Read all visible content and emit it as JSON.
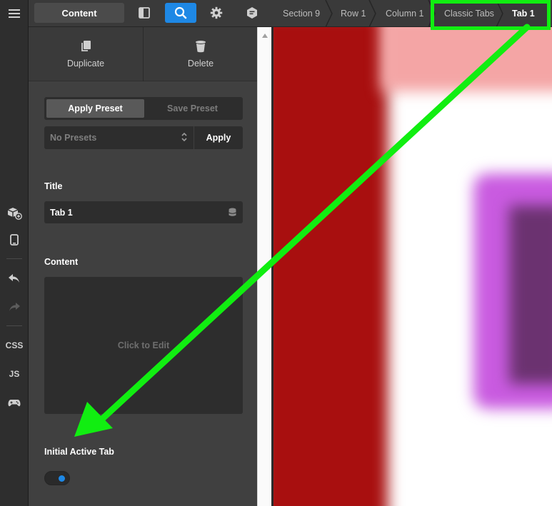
{
  "toolbar": {
    "content_label": "Content",
    "icons": [
      "panel-toggle-icon",
      "search-icon",
      "gear-icon",
      "chat-icon"
    ]
  },
  "breadcrumbs": [
    "Section 9",
    "Row 1",
    "Column 1",
    "Classic Tabs",
    "Tab 1"
  ],
  "rail": {
    "css_label": "CSS",
    "js_label": "JS"
  },
  "actions": {
    "duplicate_label": "Duplicate",
    "delete_label": "Delete"
  },
  "presets": {
    "apply_tab": "Apply Preset",
    "save_tab": "Save Preset",
    "select_value": "No Presets",
    "apply_button": "Apply"
  },
  "title_field": {
    "label": "Title",
    "value": "Tab 1"
  },
  "content_field": {
    "label": "Content",
    "placeholder": "Click to Edit"
  },
  "initial_active_tab": {
    "label": "Initial Active Tab",
    "enabled": true
  },
  "colors": {
    "accent": "#1e88e5",
    "annotation": "#11ee11",
    "preview_red": "#b01010",
    "preview_purple": "#c44ad9"
  }
}
